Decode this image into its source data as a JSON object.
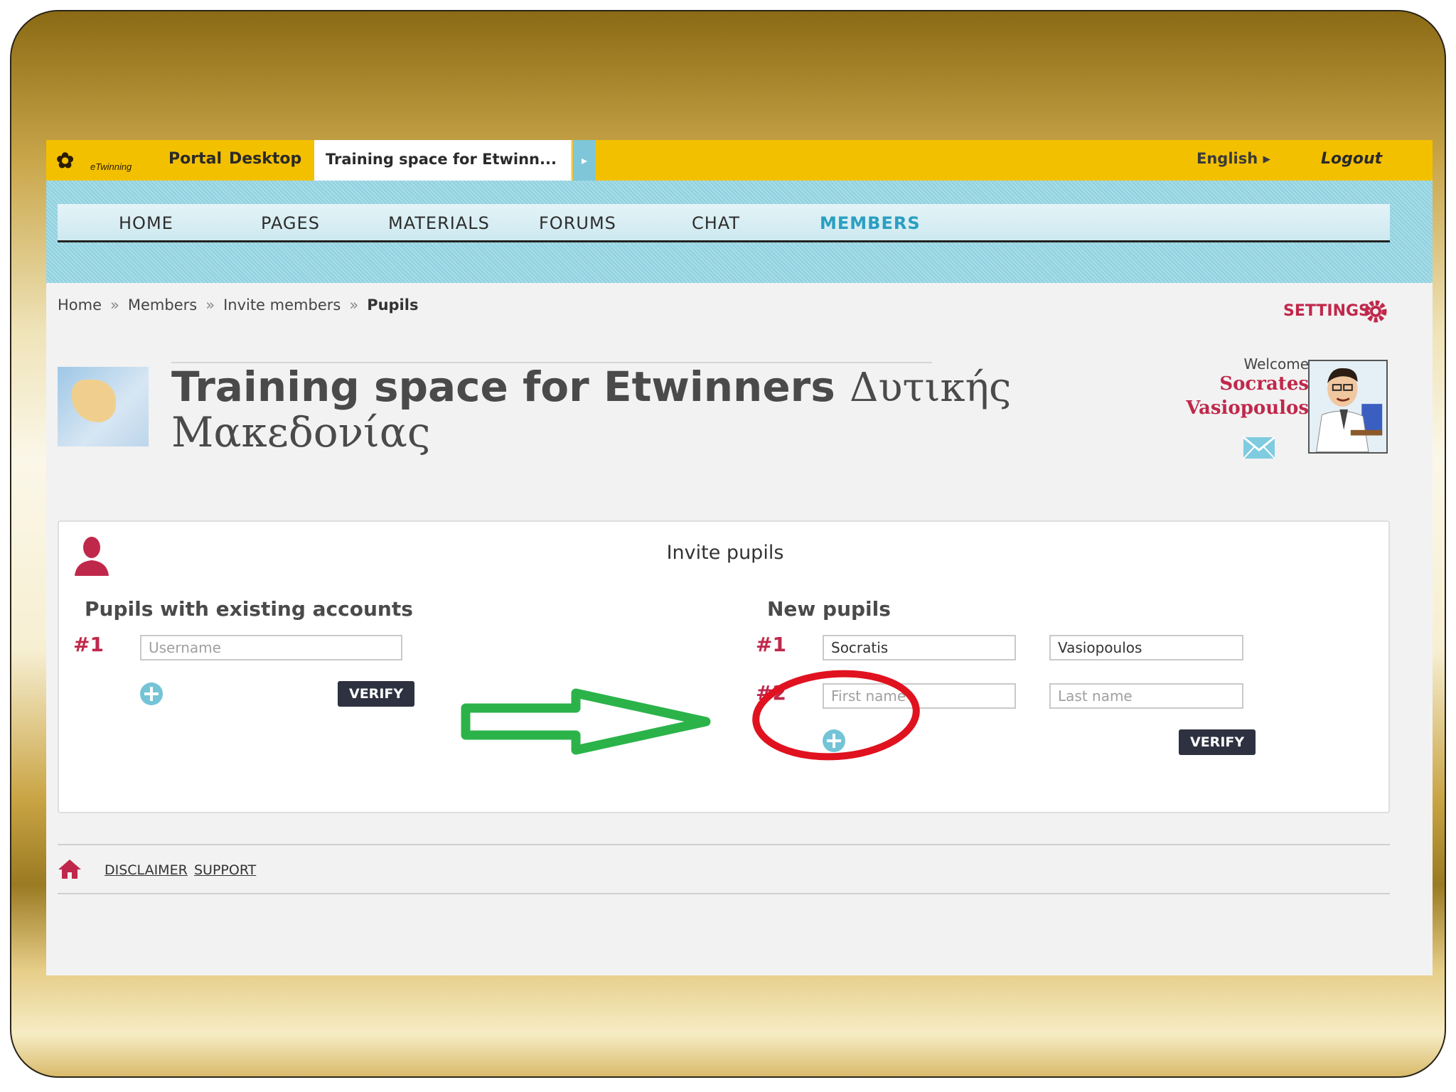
{
  "topbar": {
    "logo_text": "eTwinning",
    "portal": "Portal",
    "desktop": "Desktop",
    "space_tab": "Training space for Etwinn...",
    "language": "English ▸",
    "logout": "Logout"
  },
  "nav": [
    "HOME",
    "PAGES",
    "MATERIALS",
    "FORUMS",
    "CHAT",
    "MEMBERS"
  ],
  "breadcrumb": [
    "Home",
    "Members",
    "Invite members",
    "Pupils"
  ],
  "settings": "SETTINGS",
  "header": {
    "title_latin": "Training space for Etwinners",
    "title_greek_1": "Δυτικής",
    "title_greek_2": "Μακεδονίας"
  },
  "user": {
    "welcome": "Welcome",
    "first_name": "Socrates",
    "last_name": "Vasiopoulos"
  },
  "invite": {
    "title": "Invite pupils",
    "existing": {
      "heading": "Pupils with existing accounts",
      "row_num": "#1",
      "username_placeholder": "Username",
      "verify": "VERIFY"
    },
    "new": {
      "heading": "New pupils",
      "rows": [
        {
          "num": "#1",
          "first": "Socratis",
          "last": "Vasiopoulos"
        },
        {
          "num": "#2",
          "first": "",
          "last": ""
        }
      ],
      "first_placeholder": "First name",
      "last_placeholder": "Last name",
      "verify": "VERIFY"
    }
  },
  "footer": {
    "disclaimer": "DISCLAIMER",
    "support": "SUPPORT"
  },
  "colors": {
    "topbar": "#f3c000",
    "accent_red": "#c0284b",
    "nav_active": "#2a9fc1",
    "arrow": "#2bb34a",
    "circle": "#e0121f"
  }
}
